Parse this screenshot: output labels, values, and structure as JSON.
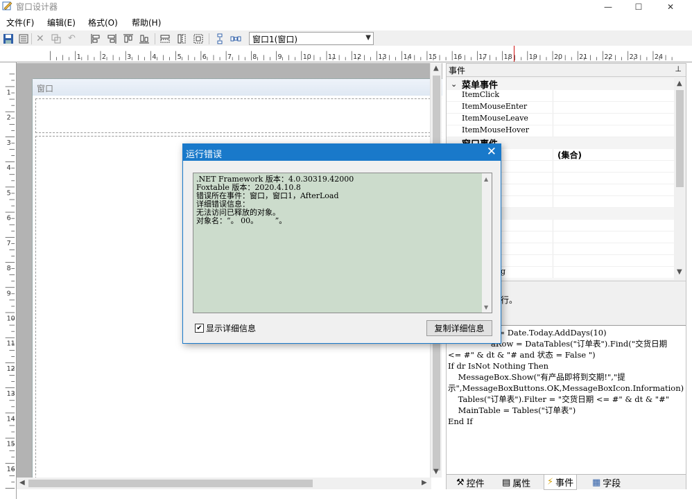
{
  "window": {
    "title": "窗口设计器",
    "minimize": "—",
    "maximize": "☐",
    "close": "✕"
  },
  "menu": [
    "文件(F)",
    "编辑(E)",
    "格式(O)",
    "帮助(H)"
  ],
  "toolbar": {
    "form_select": "窗口1(窗口)"
  },
  "ruler": {
    "h": [
      "1",
      "2",
      "3",
      "4",
      "5",
      "6",
      "7",
      "8",
      "9",
      "10",
      "11",
      "12",
      "13",
      "14",
      "15",
      "16",
      "17",
      "18",
      "19",
      "20",
      "21",
      "22",
      "23",
      "24"
    ],
    "v": [
      "1",
      "2",
      "3",
      "4",
      "5",
      "6",
      "7",
      "8",
      "9",
      "10",
      "11",
      "12",
      "13",
      "14",
      "15",
      "16"
    ]
  },
  "designer": {
    "form_title": "窗口"
  },
  "panel": {
    "title": "事件",
    "pin": "ᵖ",
    "categories": [
      {
        "name": "菜单事件",
        "items": [
          "ItemClick",
          "ItemMouseEnter",
          "ItemMouseLeave",
          "ItemMouseHover"
        ]
      }
    ],
    "hidden_category": "窗口事件",
    "partial_rows": [
      "e",
      "se",
      "ed",
      "",
      "",
      "",
      "ck",
      "",
      "",
      "g"
    ],
    "collection_label": "(集合)",
    "description_tail": "行。",
    "code": [
      "e = Date.Today.AddDays(10)",
      "aRow = DataTables(\"订单表\").Find(\"交货日期",
      "<= #\" & dt & \"# and 状态 = False \")",
      "If dr IsNot Nothing Then",
      "    MessageBox.Show(\"有产品即将到交期!\",\"提",
      "示\",MessageBoxButtons.OK,MessageBoxIcon.Information)",
      "    Tables(\"订单表\").Filter = \"交货日期 <= #\" & dt & \"#\"",
      "    MainTable = Tables(\"订单表\")",
      "End If"
    ],
    "tabs": [
      "控件",
      "属性",
      "事件",
      "字段"
    ],
    "active_tab": 2
  },
  "dialog": {
    "title": "运行错误",
    "close": "✕",
    "lines": [
      ".NET Framework 版本：4.0.30319.42000",
      "Foxtable 版本：2020.4.10.8",
      "错误所在事件：窗口，窗口1，AfterLoad",
      "详细错误信息：",
      "无法访问已释放的对象。",
      "对象名：“。 00。       ”。"
    ],
    "checkbox_label": "显示详细信息",
    "checkbox_checked": "✔",
    "copy_button": "复制详细信息"
  }
}
